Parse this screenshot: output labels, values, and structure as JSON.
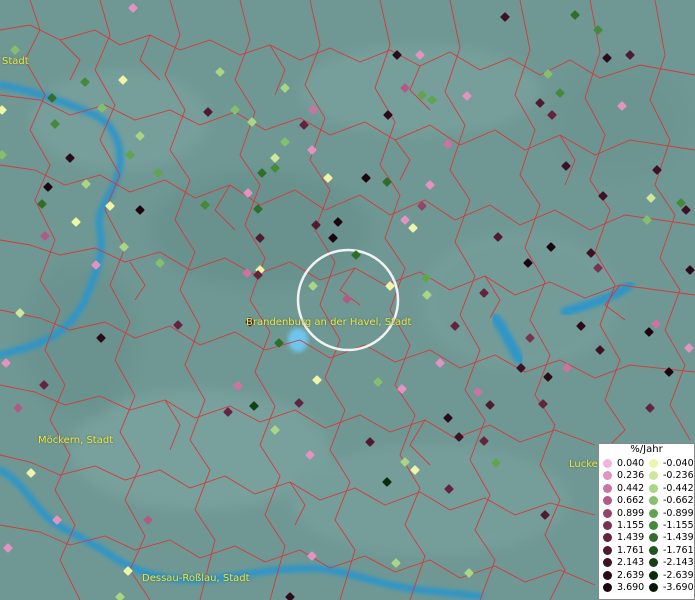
{
  "places": [
    {
      "id": "top-left",
      "label": "Stadt"
    },
    {
      "id": "brandenburg",
      "label": "Brandenburg an der Havel, Stadt"
    },
    {
      "id": "moeckern",
      "label": "Möckern, Stadt"
    },
    {
      "id": "luckenwalde",
      "label": "Lucke"
    },
    {
      "id": "dessau",
      "label": "Dessau-Roßlau, Stadt"
    }
  ],
  "legend": {
    "title": "%/Jahr",
    "positive": [
      {
        "value": "0.040",
        "color": "#f3b4dc"
      },
      {
        "value": "0.236",
        "color": "#e393c0"
      },
      {
        "value": "0.442",
        "color": "#cc73a2"
      },
      {
        "value": "0.662",
        "color": "#b05a86"
      },
      {
        "value": "0.899",
        "color": "#93446b"
      },
      {
        "value": "1.155",
        "color": "#7a3253"
      },
      {
        "value": "1.439",
        "color": "#632440"
      },
      {
        "value": "1.761",
        "color": "#501a31"
      },
      {
        "value": "2.143",
        "color": "#3e1225"
      },
      {
        "value": "2.639",
        "color": "#2c0b19"
      },
      {
        "value": "3.690",
        "color": "#1c050e"
      }
    ],
    "negative": [
      {
        "value": "-0.040",
        "color": "#eef5a8"
      },
      {
        "value": "-0.236",
        "color": "#cde89c"
      },
      {
        "value": "-0.442",
        "color": "#a9d685"
      },
      {
        "value": "-0.662",
        "color": "#84c06b"
      },
      {
        "value": "-0.899",
        "color": "#5fa550"
      },
      {
        "value": "-1.155",
        "color": "#448a3b"
      },
      {
        "value": "-1.439",
        "color": "#2f6f2a"
      },
      {
        "value": "-1.761",
        "color": "#20571e"
      },
      {
        "value": "-2.143",
        "color": "#144013"
      },
      {
        "value": "-2.639",
        "color": "#0b2b0b"
      },
      {
        "value": "-3.690",
        "color": "#041a04"
      }
    ]
  }
}
